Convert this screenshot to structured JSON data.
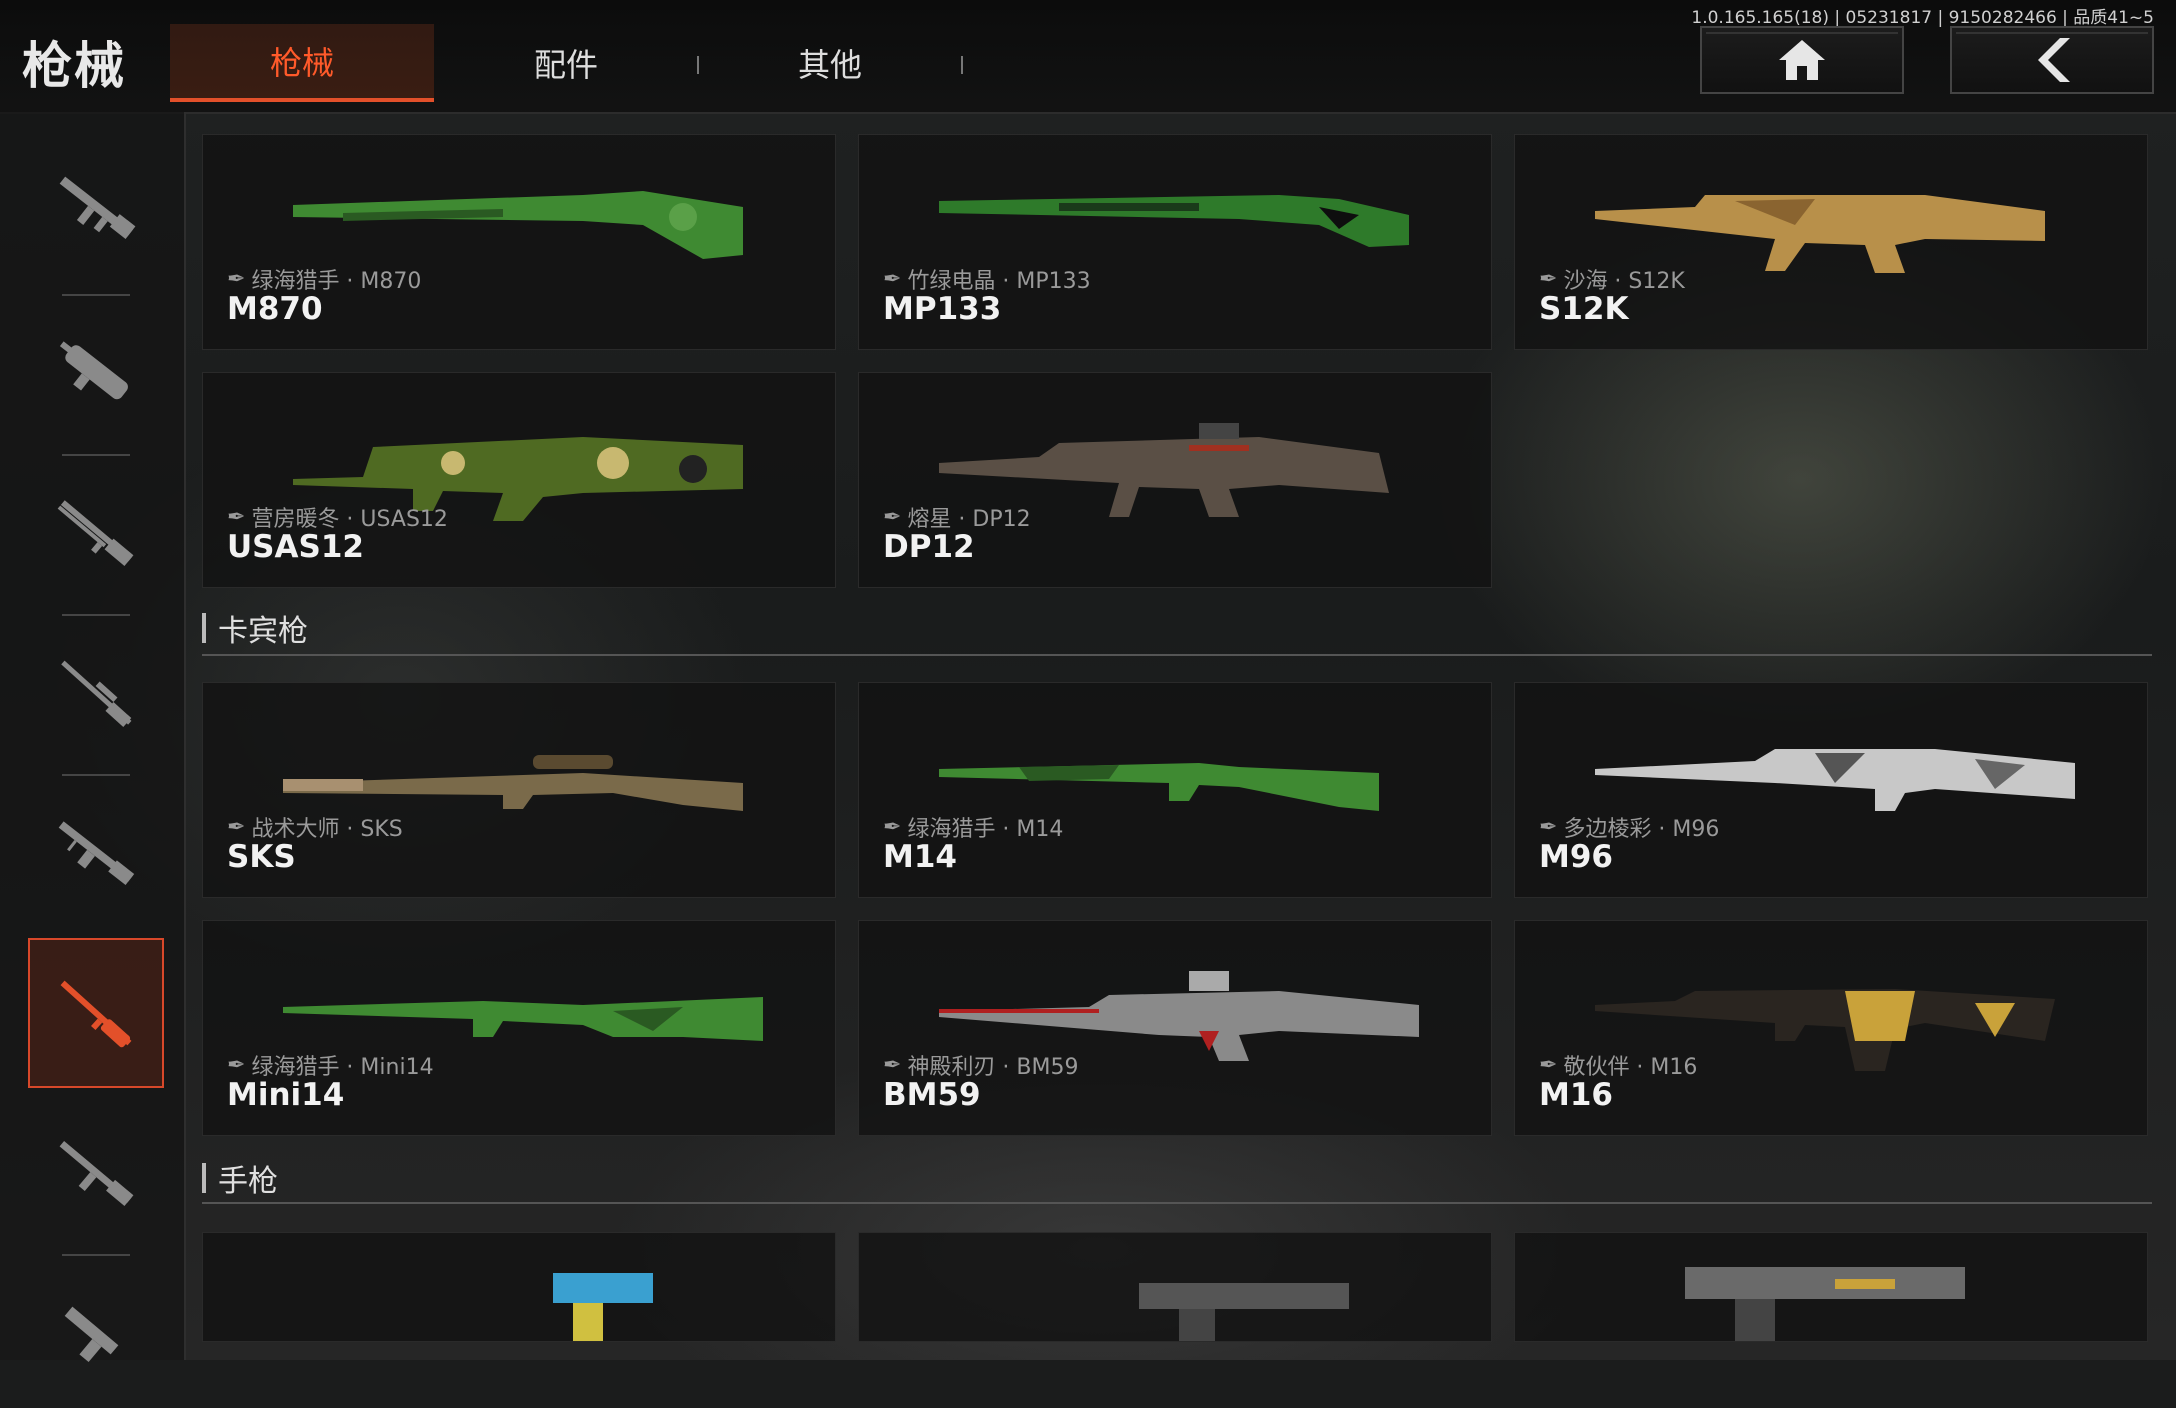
{
  "header": {
    "title": "枪械",
    "version": "1.0.165.165(18) | 05231817 | 9150282466 | 品质41~5"
  },
  "tabs": [
    {
      "label": "枪械"
    },
    {
      "label": "配件"
    },
    {
      "label": "其他"
    }
  ],
  "nav": {
    "home_icon": "home-icon",
    "back_icon": "chevron-left-icon"
  },
  "sidebar": [
    {
      "icon": "assault-rifle-icon"
    },
    {
      "icon": "smg-icon"
    },
    {
      "icon": "shotgun-icon"
    },
    {
      "icon": "sniper-rifle-icon"
    },
    {
      "icon": "lmg-icon"
    },
    {
      "icon": "carbine-icon",
      "active": true
    },
    {
      "icon": "rifle-icon"
    },
    {
      "icon": "pistol-icon"
    }
  ],
  "shotguns": [
    {
      "skin": "绿海猎手 · M870",
      "name": "M870",
      "color": "#3f8a32"
    },
    {
      "skin": "竹绿电晶 · MP133",
      "name": "MP133",
      "color": "#2e7a2a"
    },
    {
      "skin": "沙海 · S12K",
      "name": "S12K",
      "color": "#b8904a"
    },
    {
      "skin": "营房暖冬 · USAS12",
      "name": "USAS12",
      "color": "#4f6a22"
    },
    {
      "skin": "熔星 · DP12",
      "name": "DP12",
      "color": "#6a5a48"
    }
  ],
  "carbines": {
    "title": "卡宾枪",
    "items": [
      {
        "skin": "战术大师 · SKS",
        "name": "SKS",
        "color": "#7a6a4a"
      },
      {
        "skin": "绿海猎手 · M14",
        "name": "M14",
        "color": "#3f8a32"
      },
      {
        "skin": "多边棱彩 · M96",
        "name": "M96",
        "color": "#c8c8c8"
      },
      {
        "skin": "绿海猎手 · Mini14",
        "name": "Mini14",
        "color": "#3f8a32"
      },
      {
        "skin": "神殿利刃 · BM59",
        "name": "BM59",
        "color": "#8a8a8a"
      },
      {
        "skin": "敬伙伴 · M16",
        "name": "M16",
        "color": "#c9a23a"
      }
    ]
  },
  "pistols": {
    "title": "手枪"
  }
}
